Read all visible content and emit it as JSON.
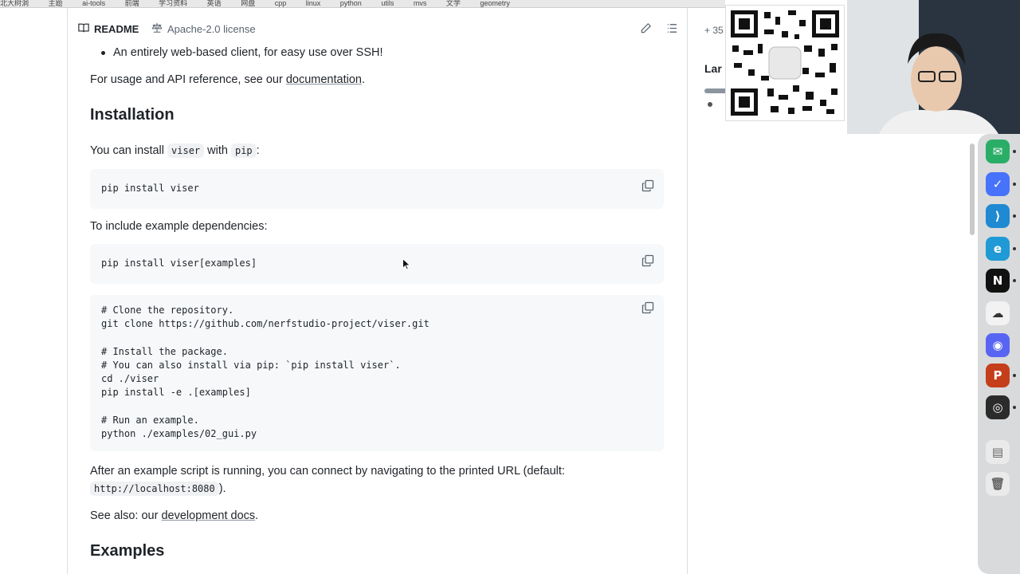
{
  "bookmarks": [
    "北大树洞",
    "主题",
    "ai-tools",
    "前端",
    "学习资料",
    "英语",
    "网盘",
    "cpp",
    "linux",
    "python",
    "utils",
    "mvs",
    "文学",
    "geometry"
  ],
  "readme_tabs": {
    "readme": "README",
    "license": "Apache-2.0 license"
  },
  "content": {
    "bullet_web_client": "An entirely web-based client, for easy use over SSH!",
    "usage_prefix": "For usage and API reference, see our ",
    "usage_link": "documentation",
    "usage_suffix": ".",
    "installation_heading": "Installation",
    "install_prefix": "You can install ",
    "install_code1": "viser",
    "install_mid": " with ",
    "install_code2": "pip",
    "install_suffix": ":",
    "code_pip_install": "pip install viser",
    "examples_deps_text": "To include example dependencies:",
    "code_pip_install_examples": "pip install viser[examples]",
    "code_clone_block": "# Clone the repository.\ngit clone https://github.com/nerfstudio-project/viser.git\n\n# Install the package.\n# You can also install via pip: `pip install viser`.\ncd ./viser\npip install -e .[examples]\n\n# Run an example.\npython ./examples/02_gui.py",
    "after_text": "After an example script is running, you can connect by navigating to the printed URL (default:",
    "after_code": "http://localhost:8080",
    "after_suffix": ").",
    "see_also_prefix": "See also: our ",
    "see_also_link": "development docs",
    "see_also_suffix": ".",
    "examples_heading": "Examples"
  },
  "sidebar": {
    "count_partial": "+ 35",
    "languages_partial": "Lar"
  },
  "dock": {
    "apps": [
      {
        "name": "wechat",
        "color": "#2aae67",
        "glyph": "✉"
      },
      {
        "name": "ticktick",
        "color": "#4772fa",
        "glyph": "✓"
      },
      {
        "name": "vscode",
        "color": "#1f8ad2",
        "glyph": "⟩"
      },
      {
        "name": "edge",
        "color": "#1f9ad6",
        "glyph": "e"
      },
      {
        "name": "notion",
        "color": "#111111",
        "glyph": "N"
      },
      {
        "name": "cloud",
        "color": "#f2f2f2",
        "glyph": "☁"
      },
      {
        "name": "discord",
        "color": "#5865f2",
        "glyph": "◉"
      },
      {
        "name": "powerpoint",
        "color": "#c43e1c",
        "glyph": "P"
      },
      {
        "name": "obs",
        "color": "#2b2b2b",
        "glyph": "◎"
      },
      {
        "name": "finder-doc",
        "color": "#eaeaea",
        "glyph": "▤"
      },
      {
        "name": "trash",
        "color": "#eaeaea",
        "glyph": "🗑"
      }
    ]
  }
}
